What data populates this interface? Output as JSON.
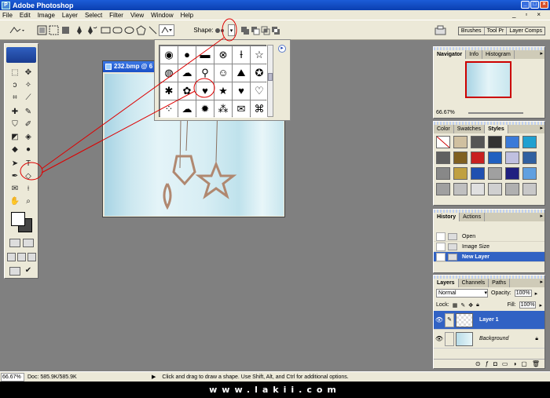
{
  "window": {
    "title": "Adobe Photoshop"
  },
  "menu": [
    "File",
    "Edit",
    "Image",
    "Layer",
    "Select",
    "Filter",
    "View",
    "Window",
    "Help"
  ],
  "options": {
    "shape_label": "Shape:"
  },
  "panel_well": [
    "Brushes",
    "Tool Pr",
    "Layer Comps"
  ],
  "document": {
    "title": "232.bmp @ 6"
  },
  "shape_picker": {
    "shapes": [
      "◉",
      "●",
      "▬",
      "⊗",
      "Ɨ",
      "☆",
      "◍",
      "☁",
      "⚲",
      "☺",
      "⛰",
      "✪",
      "✱",
      "✿",
      "♥",
      "★",
      "♥",
      "♡",
      "⁘",
      "☁",
      "✹",
      "⁂",
      "✉",
      "⌘"
    ],
    "selected_index": 14
  },
  "navigator": {
    "tabs": [
      "Navigator",
      "Info",
      "Histogram"
    ],
    "zoom": "66.67%"
  },
  "styles": {
    "tabs": [
      "Color",
      "Swatches",
      "Styles"
    ],
    "swatches": [
      "#ffffff",
      "#d0c0a0",
      "#555555",
      "#333333",
      "#3a7ad8",
      "#20a0d0",
      "#606060",
      "#806020",
      "#c82020",
      "#2060c0",
      "#c0c0e0",
      "#3060a0",
      "#888888",
      "#c0a040",
      "#2050b0",
      "#a0a0a0",
      "#202080",
      "#60a0e0",
      "#a0a0a0",
      "#c0c0c0",
      "#e0e0e0",
      "#d0d0d0",
      "#b0b0b0",
      "#c8c8c8"
    ]
  },
  "history": {
    "tabs": [
      "History",
      "Actions"
    ],
    "items": [
      "Open",
      "Image Size",
      "New Layer"
    ]
  },
  "layers": {
    "tabs": [
      "Layers",
      "Channels",
      "Paths"
    ],
    "blend_mode": "Normal",
    "opacity_label": "Opacity:",
    "opacity": "100%",
    "lock_label": "Lock:",
    "fill_label": "Fill:",
    "fill": "100%",
    "items": [
      "Layer 1",
      "Background"
    ]
  },
  "status": {
    "zoom": "66.67%",
    "doc": "Doc: 585.9K/585.9K",
    "hint": "Click and drag to draw a shape. Use Shift, Alt, and Ctrl for additional options."
  },
  "footer": "www.lakii.com",
  "colors": {
    "title_blue": "#0a3fb0",
    "chrome": "#ece9d8",
    "workspace": "#808080",
    "selection": "#3162c4",
    "annotation": "#dd0000"
  }
}
